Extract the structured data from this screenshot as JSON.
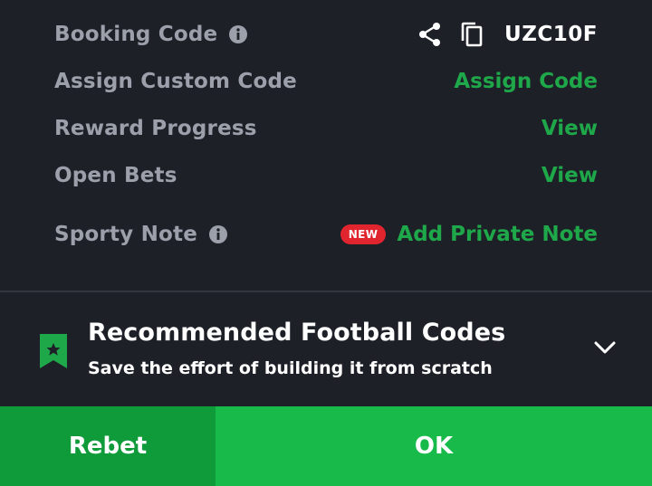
{
  "colors": {
    "background": "#1e2028",
    "label": "#9ba0aa",
    "accent_green": "#1ea84a",
    "rebet_bg": "#0f9b3a",
    "ok_bg": "#18bb4a",
    "badge_red": "#e1252f"
  },
  "booking": {
    "label": "Booking Code",
    "info_icon": "info-icon",
    "share_icon": "share-icon",
    "copy_icon": "copy-icon",
    "code": "UZC10F"
  },
  "custom_code": {
    "label": "Assign Custom Code",
    "action": "Assign Code"
  },
  "reward_progress": {
    "label": "Reward Progress",
    "action": "View"
  },
  "open_bets": {
    "label": "Open Bets",
    "action": "View"
  },
  "sporty_note": {
    "label": "Sporty Note",
    "info_icon": "info-icon",
    "badge": "NEW",
    "action": "Add Private Note"
  },
  "recommended": {
    "icon": "bookmark-star-icon",
    "title": "Recommended Football Codes",
    "subtitle": "Save the effort of building it from scratch",
    "toggle_icon": "chevron-down-icon"
  },
  "footer": {
    "rebet_label": "Rebet",
    "ok_label": "OK"
  }
}
